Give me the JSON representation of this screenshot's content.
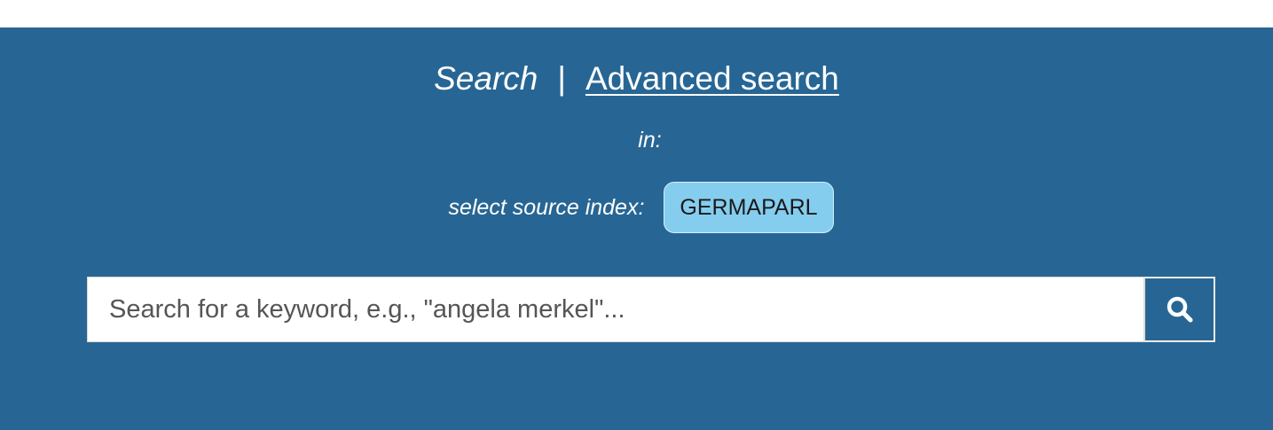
{
  "search_modes": {
    "search_label": "Search",
    "separator": "|",
    "advanced_label": "Advanced search"
  },
  "in_label": "in:",
  "source_index": {
    "label": "select source index:",
    "selected": "GERMAPARL"
  },
  "search": {
    "placeholder": "Search for a keyword, e.g., \"angela merkel\"...",
    "value": "",
    "button_icon": "search-icon"
  },
  "colors": {
    "panel_background": "#276694",
    "chip_background": "#85cdef",
    "text": "#ffffff"
  }
}
